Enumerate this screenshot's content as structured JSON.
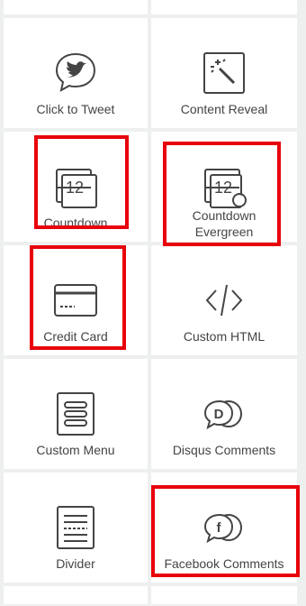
{
  "widgets": [
    {
      "label": "Click to Tweet",
      "icon": "twitter-bubble-icon"
    },
    {
      "label": "Content Reveal",
      "icon": "magic-wand-icon"
    },
    {
      "label": "Countdown",
      "icon": "countdown-icon"
    },
    {
      "label": "Countdown",
      "label2": "Evergreen",
      "icon": "countdown-evergreen-icon"
    },
    {
      "label": "Credit Card",
      "icon": "credit-card-icon"
    },
    {
      "label": "Custom HTML",
      "icon": "code-icon"
    },
    {
      "label": "Custom Menu",
      "icon": "menu-icon"
    },
    {
      "label": "Disqus Comments",
      "icon": "disqus-icon"
    },
    {
      "label": "Divider",
      "icon": "divider-icon"
    },
    {
      "label": "Facebook Comments",
      "icon": "facebook-comments-icon"
    }
  ],
  "highlight_color": "#e8000b"
}
